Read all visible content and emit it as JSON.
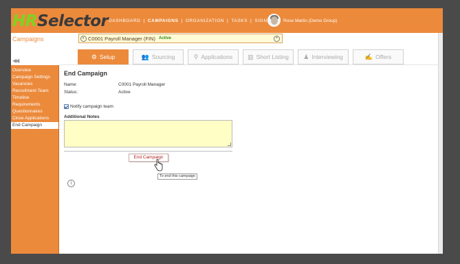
{
  "app": {
    "logo_hr": "HR",
    "logo_selector": "Selector"
  },
  "topnav": {
    "items": [
      "DASHBOARD",
      "CAMPAIGNS",
      "ORGANIZATION",
      "TASKS",
      "SIGN-OUT"
    ],
    "active": "CAMPAIGNS",
    "separator": "|"
  },
  "user": {
    "name": "Rose Martin (Demo Group)"
  },
  "header": {
    "section_title": "Campaigns",
    "campaign_name": "C0001 Payroll Manager (FIN)",
    "campaign_status": "Active",
    "left_button_glyph": "◐",
    "right_button_glyph": "+"
  },
  "collapse_glyph": "◀◀",
  "tabs": [
    {
      "label": "Setup",
      "icon": "gear-icon",
      "glyph": "⚙",
      "active": true
    },
    {
      "label": "Sourcing",
      "icon": "people-icon",
      "glyph": "👥",
      "active": false
    },
    {
      "label": "Applications",
      "icon": "applicants-icon",
      "glyph": "⚲",
      "active": false
    },
    {
      "label": "Short Listing",
      "icon": "shortlist-icon",
      "glyph": "▥",
      "active": false
    },
    {
      "label": "Interviewing",
      "icon": "interview-icon",
      "glyph": "♟",
      "active": false
    },
    {
      "label": "Offers",
      "icon": "offer-icon",
      "glyph": "✍",
      "active": false
    }
  ],
  "sidebar": {
    "items": [
      "Overview",
      "Campaign Settings",
      "Vacancies",
      "Recruitment Team",
      "Timeline",
      "Requirements",
      "Questionnaires",
      "Close Applications",
      "End Campaign"
    ],
    "active": "End Campaign"
  },
  "main": {
    "title": "End Campaign",
    "fields": [
      {
        "label": "Name:",
        "value": "C0001 Payroll Manager"
      },
      {
        "label": "Status:",
        "value": "Active"
      }
    ],
    "notify_label": "Notify campaign team",
    "notify_checked": true,
    "notes_label": "Additional Notes",
    "notes_value": "",
    "end_button_label": "End Campaign",
    "tooltip": "To end this campaign",
    "info_glyph": "i"
  },
  "colors": {
    "accent": "#ec8a3c",
    "logo_green": "#7ed321",
    "notes_bg": "#ffffc5",
    "status_green": "#2e8b1e",
    "button_text": "#b22222"
  }
}
